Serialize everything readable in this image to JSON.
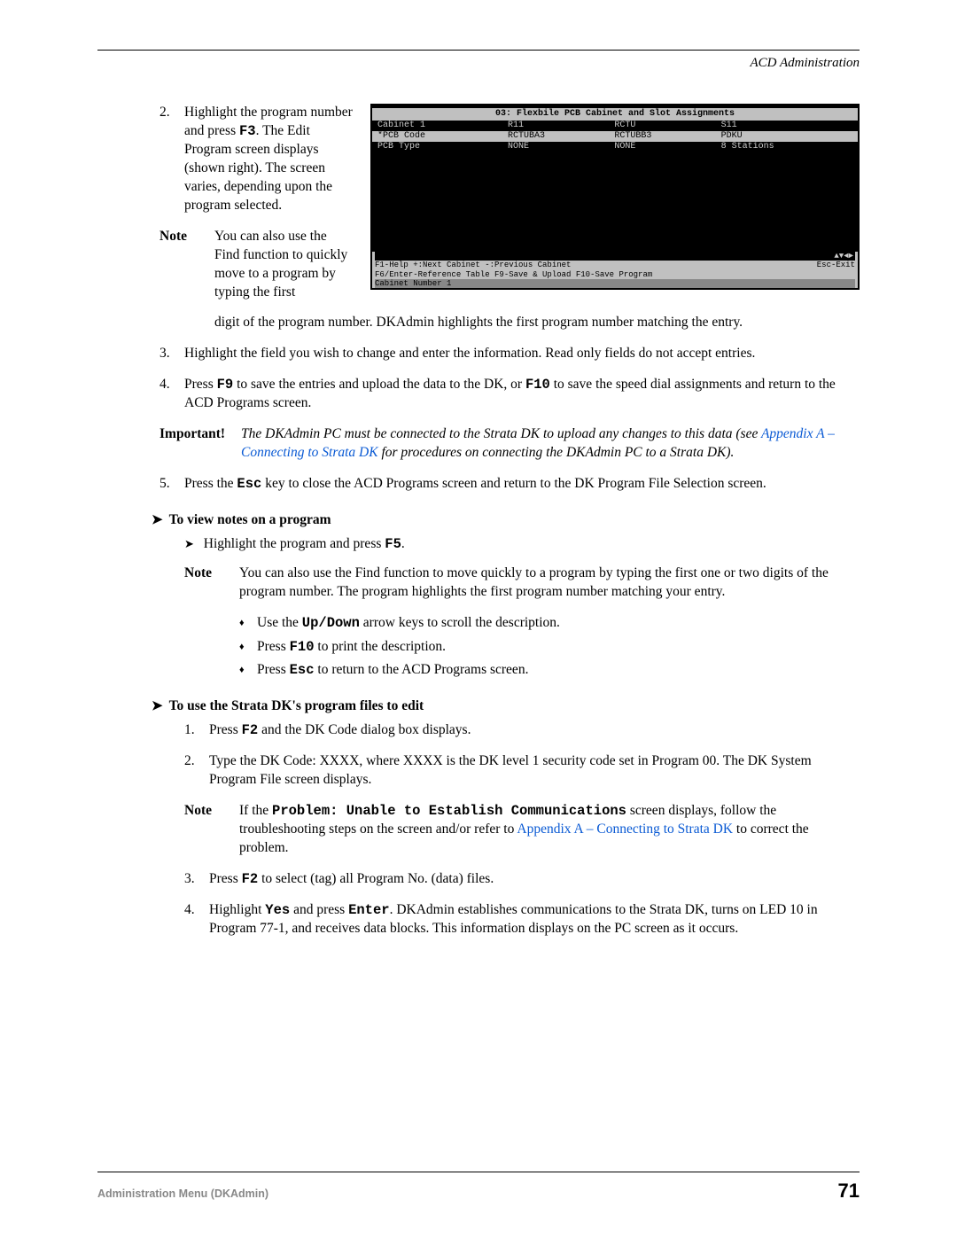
{
  "header": {
    "title": "ACD Administration"
  },
  "screenshot": {
    "title": "03: Flexbile PCB Cabinet and Slot Assignments",
    "cols": [
      "Cabinet 1",
      "R11",
      "RCTU",
      "S11"
    ],
    "rows": [
      {
        "label": "*PCB Code",
        "c1": "RCTUBA3",
        "c2": "RCTUBB3",
        "c3": "PDKU"
      },
      {
        "label": "PCB Type",
        "c1": "NONE",
        "c2": "NONE",
        "c3": "8 Stations"
      }
    ],
    "nav_symbols": "▲▼◄►",
    "foot1_left": "F1-Help  +:Next Cabinet  -:Previous Cabinet",
    "foot1_right": "Esc-Exit",
    "foot2": "F6/Enter-Reference Table  F9-Save & Upload  F10-Save Program",
    "bottom": "Cabinet Number 1"
  },
  "step2": {
    "num": "2.",
    "p1a": "Highlight the program number and press ",
    "p1_key": "F3",
    "p1b": ". The Edit Program screen displays (shown right). The screen varies, depending upon the program selected."
  },
  "note1": {
    "label": "Note",
    "text_a": "You can also use the Find function to quickly move to a program by typing the first"
  },
  "note1_cont": "digit of the program number. DKAdmin highlights the first program number matching the entry.",
  "step3": {
    "num": "3.",
    "text": "Highlight the field you wish to change and enter the information. Read only fields do not accept entries."
  },
  "step4": {
    "num": "4.",
    "a": "Press ",
    "k1": "F9",
    "b": " to save the entries and upload the data to the DK, or ",
    "k2": "F10",
    "c": " to save the speed dial assignments and return to the ACD Programs screen."
  },
  "important": {
    "label": "Important!",
    "a": "The DKAdmin PC must be connected to the Strata DK to upload any changes to this data (see ",
    "link": "Appendix A – Connecting to Strata DK",
    "b": " for procedures on connecting the DKAdmin PC to a Strata DK)."
  },
  "step5": {
    "num": "5.",
    "a": "Press the ",
    "k": "Esc",
    "b": " key to close the ACD Programs screen and return to the DK Program File Selection screen."
  },
  "heading_view": "To view notes on a program",
  "sub_view": {
    "a": "Highlight the program and press ",
    "k": "F5",
    "b": "."
  },
  "note2": {
    "label": "Note",
    "text": "You can also use the Find function to move quickly to a program by typing the first one or two digits of the program number. The program highlights the first program number matching your entry."
  },
  "d1": {
    "a": "Use the ",
    "k": "Up/Down",
    "b": " arrow keys to scroll the description."
  },
  "d2": {
    "a": "Press ",
    "k": "F10",
    "b": " to print the description."
  },
  "d3": {
    "a": "Press ",
    "k": "Esc",
    "b": " to return to the ACD Programs screen."
  },
  "heading_use": "To use the Strata DK's program files to edit",
  "u1": {
    "num": "1.",
    "a": "Press ",
    "k": "F2",
    "b": " and the DK Code dialog box displays."
  },
  "u2": {
    "num": "2.",
    "text": "Type the DK Code: XXXX, where XXXX is the DK level 1 security code set in Program 00. The DK System Program File screen displays."
  },
  "note3": {
    "label": "Note",
    "a": "If the ",
    "k": "Problem: Unable to Establish Communications",
    "b": " screen displays, follow the troubleshooting steps on the screen and/or refer to ",
    "link": "Appendix A – Connecting to Strata DK",
    "c": " to correct the problem."
  },
  "u3": {
    "num": "3.",
    "a": "Press ",
    "k": "F2",
    "b": " to select (tag) all Program No. (data) files."
  },
  "u4": {
    "num": "4.",
    "a": "Highlight ",
    "k1": "Yes",
    "b": " and press ",
    "k2": "Enter",
    "c": ". DKAdmin establishes communications to the Strata DK, turns on LED 10 in Program 77-1, and receives data blocks. This information displays on the PC screen as it occurs."
  },
  "footer": {
    "left": "Administration Menu (DKAdmin)",
    "page": "71"
  }
}
